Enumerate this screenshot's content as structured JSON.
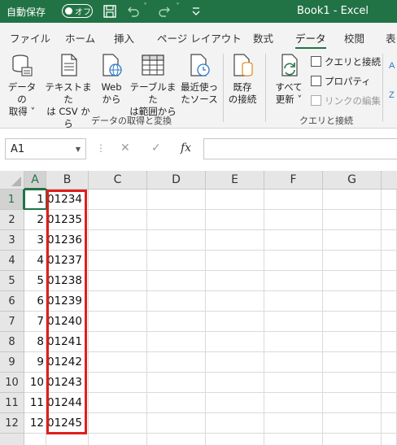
{
  "titlebar": {
    "autosave_label": "自動保存",
    "toggle_state": "オフ",
    "title": "Book1  -  Excel",
    "icons": [
      "save-icon",
      "undo-icon",
      "redo-icon",
      "customize-qat-icon"
    ]
  },
  "tabs": [
    {
      "label": "ファイル",
      "active": false
    },
    {
      "label": "ホーム",
      "active": false
    },
    {
      "label": "挿入",
      "active": false
    },
    {
      "label": "ページ レイアウト",
      "active": false
    },
    {
      "label": "数式",
      "active": false
    },
    {
      "label": "データ",
      "active": true
    },
    {
      "label": "校閲",
      "active": false
    },
    {
      "label": "表",
      "active": false
    }
  ],
  "ribbon": {
    "get_data": {
      "line1": "データの",
      "line2": "取得 ˅"
    },
    "from_text": {
      "line1": "テキストまた",
      "line2": "は CSV から"
    },
    "from_web": {
      "line1": "Web",
      "line2": "から"
    },
    "from_table": {
      "line1": "テーブルまた",
      "line2": "は範囲から"
    },
    "recent_sources": {
      "line1": "最近使っ",
      "line2": "たソース"
    },
    "existing_conn": {
      "line1": "既存",
      "line2": "の接続"
    },
    "group_get_transform": "データの取得と変換",
    "refresh_all": {
      "line1": "すべて",
      "line2": "更新 ˅"
    },
    "queries_connections": "クエリと接続",
    "properties": "プロパティ",
    "edit_links": "リンクの編集",
    "group_queries": "クエリと接続"
  },
  "formula_bar": {
    "name_box": "A1",
    "cancel_glyph": "✕",
    "enter_glyph": "✓",
    "fx_glyph": "fx",
    "formula": ""
  },
  "sheet": {
    "columns": [
      "A",
      "B",
      "C",
      "D",
      "E",
      "F",
      "G"
    ],
    "rows": [
      "1",
      "2",
      "3",
      "4",
      "5",
      "6",
      "7",
      "8",
      "9",
      "10",
      "11",
      "12",
      ""
    ],
    "col_a": [
      "1",
      "2",
      "3",
      "4",
      "5",
      "6",
      "7",
      "8",
      "9",
      "10",
      "11",
      "12",
      ""
    ],
    "col_b": [
      "01234",
      "01235",
      "01236",
      "01237",
      "01238",
      "01239",
      "01240",
      "01241",
      "01242",
      "01243",
      "01244",
      "01245",
      ""
    ],
    "active_cell": "A1",
    "highlight_color": "#e01e1e",
    "accent_color": "#217346"
  }
}
